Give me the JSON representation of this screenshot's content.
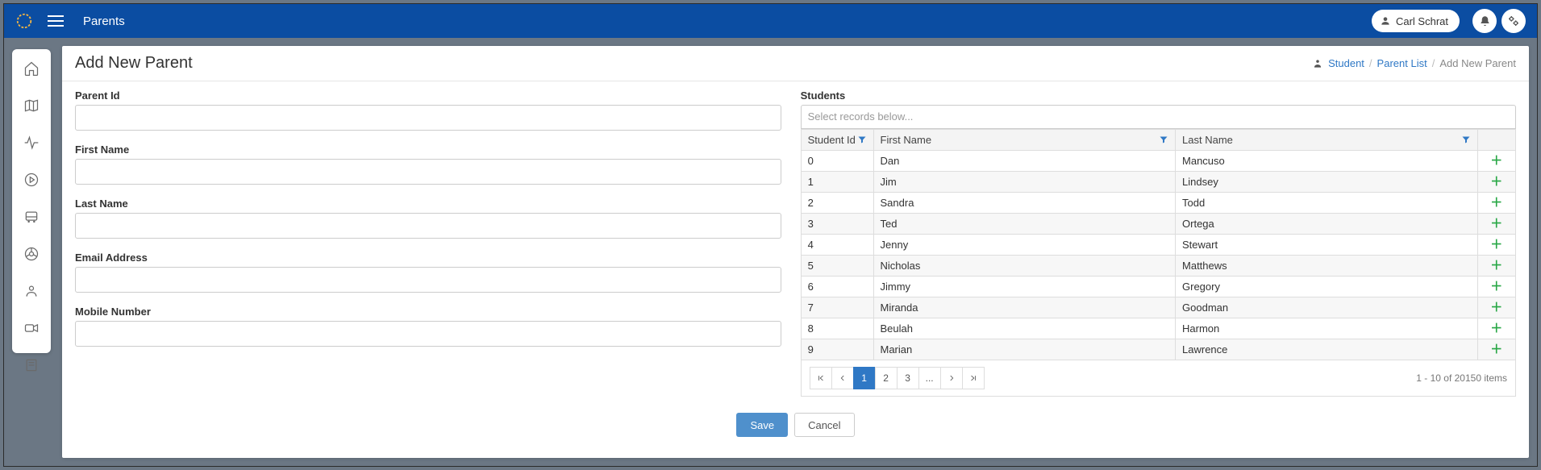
{
  "topbar": {
    "title": "Parents",
    "user_name": "Carl Schrat"
  },
  "page": {
    "title": "Add New Parent"
  },
  "breadcrumbs": {
    "student": "Student",
    "parent_list": "Parent List",
    "current": "Add New Parent"
  },
  "form": {
    "parent_id": {
      "label": "Parent Id",
      "value": ""
    },
    "first_name": {
      "label": "First Name",
      "value": ""
    },
    "last_name": {
      "label": "Last Name",
      "value": ""
    },
    "email": {
      "label": "Email Address",
      "value": ""
    },
    "mobile": {
      "label": "Mobile Number",
      "value": ""
    }
  },
  "students": {
    "label": "Students",
    "select_placeholder": "Select records below...",
    "columns": {
      "id": "Student Id",
      "first_name": "First Name",
      "last_name": "Last Name"
    },
    "rows": [
      {
        "id": "0",
        "first_name": "Dan",
        "last_name": "Mancuso"
      },
      {
        "id": "1",
        "first_name": "Jim",
        "last_name": "Lindsey"
      },
      {
        "id": "2",
        "first_name": "Sandra",
        "last_name": "Todd"
      },
      {
        "id": "3",
        "first_name": "Ted",
        "last_name": "Ortega"
      },
      {
        "id": "4",
        "first_name": "Jenny",
        "last_name": "Stewart"
      },
      {
        "id": "5",
        "first_name": "Nicholas",
        "last_name": "Matthews"
      },
      {
        "id": "6",
        "first_name": "Jimmy",
        "last_name": "Gregory"
      },
      {
        "id": "7",
        "first_name": "Miranda",
        "last_name": "Goodman"
      },
      {
        "id": "8",
        "first_name": "Beulah",
        "last_name": "Harmon"
      },
      {
        "id": "9",
        "first_name": "Marian",
        "last_name": "Lawrence"
      }
    ],
    "pager": {
      "pages": [
        "1",
        "2",
        "3",
        "..."
      ],
      "active": "1",
      "status": "1 - 10 of 20150 items"
    }
  },
  "actions": {
    "save": "Save",
    "cancel": "Cancel"
  }
}
